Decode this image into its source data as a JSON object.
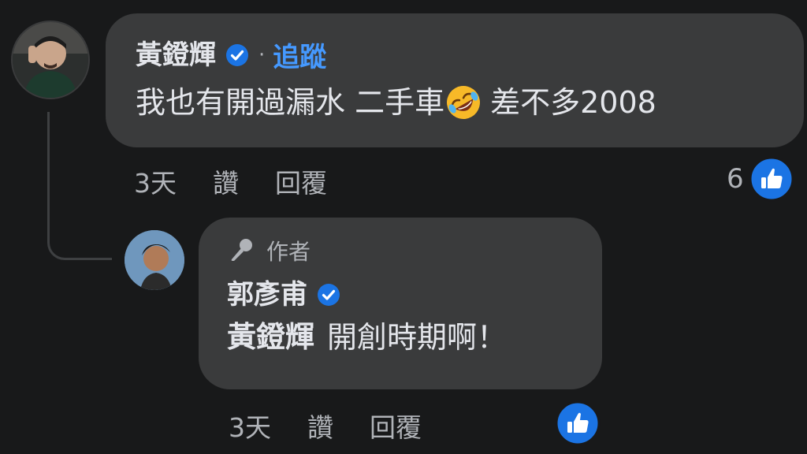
{
  "comment": {
    "author": "黃鐙輝",
    "separator": "·",
    "follow_label": "追蹤",
    "text_before_emoji": "我也有開過漏水 二手車",
    "text_after_emoji": "差不多2008",
    "emoji": "rolling-on-floor-laughing",
    "time": "3天",
    "like_label": "讚",
    "reply_label": "回覆",
    "reaction_count": "6"
  },
  "reply": {
    "author_badge": "作者",
    "author": "郭彥甫",
    "mention": "黃鐙輝",
    "text": "開創時期啊！",
    "time": "3天",
    "like_label": "讚",
    "reply_label": "回覆"
  },
  "colors": {
    "background": "#18191a",
    "bubble": "#3a3b3c",
    "link": "#4599ff",
    "verified": "#1b74e4",
    "secondary_text": "#b0b3b8"
  }
}
